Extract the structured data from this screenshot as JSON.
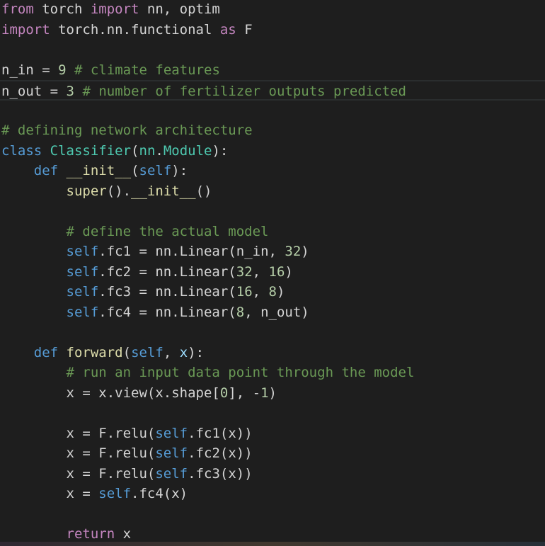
{
  "editor": {
    "lines": [
      {
        "tokens": [
          {
            "t": "from",
            "k": "keyword"
          },
          {
            "t": " torch ",
            "k": "plain"
          },
          {
            "t": "import",
            "k": "keyword"
          },
          {
            "t": " nn, optim",
            "k": "plain"
          }
        ]
      },
      {
        "tokens": [
          {
            "t": "import",
            "k": "keyword"
          },
          {
            "t": " torch.nn.functional ",
            "k": "plain"
          },
          {
            "t": "as",
            "k": "keyword"
          },
          {
            "t": " F",
            "k": "plain"
          }
        ]
      },
      {
        "tokens": []
      },
      {
        "tokens": [
          {
            "t": "n_in",
            "k": "plain"
          },
          {
            "t": " = ",
            "k": "plain"
          },
          {
            "t": "9",
            "k": "number"
          },
          {
            "t": " ",
            "k": "plain"
          },
          {
            "t": "# climate features",
            "k": "comment"
          }
        ]
      },
      {
        "current": true,
        "tokens": [
          {
            "t": "n_out",
            "k": "plain"
          },
          {
            "t": " = ",
            "k": "plain"
          },
          {
            "t": "3",
            "k": "number"
          },
          {
            "t": " ",
            "k": "plain"
          },
          {
            "t": "# number of fertilizer outputs predicted",
            "k": "comment"
          }
        ]
      },
      {
        "tokens": []
      },
      {
        "tokens": [
          {
            "t": "# defining network architecture",
            "k": "comment"
          }
        ]
      },
      {
        "tokens": [
          {
            "t": "class",
            "k": "storage"
          },
          {
            "t": " ",
            "k": "plain"
          },
          {
            "t": "Classifier",
            "k": "class"
          },
          {
            "t": "(",
            "k": "plain"
          },
          {
            "t": "nn",
            "k": "class"
          },
          {
            "t": ".",
            "k": "plain"
          },
          {
            "t": "Module",
            "k": "class"
          },
          {
            "t": "):",
            "k": "plain"
          }
        ]
      },
      {
        "tokens": [
          {
            "t": "    ",
            "k": "plain"
          },
          {
            "t": "def",
            "k": "storage"
          },
          {
            "t": " ",
            "k": "plain"
          },
          {
            "t": "__init__",
            "k": "func"
          },
          {
            "t": "(",
            "k": "plain"
          },
          {
            "t": "self",
            "k": "self"
          },
          {
            "t": "):",
            "k": "plain"
          }
        ]
      },
      {
        "tokens": [
          {
            "t": "        ",
            "k": "plain"
          },
          {
            "t": "super",
            "k": "func"
          },
          {
            "t": "().",
            "k": "plain"
          },
          {
            "t": "__init__",
            "k": "func"
          },
          {
            "t": "()",
            "k": "plain"
          }
        ]
      },
      {
        "tokens": []
      },
      {
        "tokens": [
          {
            "t": "        ",
            "k": "plain"
          },
          {
            "t": "# define the actual model",
            "k": "comment"
          }
        ]
      },
      {
        "tokens": [
          {
            "t": "        ",
            "k": "plain"
          },
          {
            "t": "self",
            "k": "self"
          },
          {
            "t": ".fc1 = nn.",
            "k": "plain"
          },
          {
            "t": "Linear",
            "k": "plain"
          },
          {
            "t": "(n_in, ",
            "k": "plain"
          },
          {
            "t": "32",
            "k": "number"
          },
          {
            "t": ")",
            "k": "plain"
          }
        ]
      },
      {
        "tokens": [
          {
            "t": "        ",
            "k": "plain"
          },
          {
            "t": "self",
            "k": "self"
          },
          {
            "t": ".fc2 = nn.Linear(",
            "k": "plain"
          },
          {
            "t": "32",
            "k": "number"
          },
          {
            "t": ", ",
            "k": "plain"
          },
          {
            "t": "16",
            "k": "number"
          },
          {
            "t": ")",
            "k": "plain"
          }
        ]
      },
      {
        "tokens": [
          {
            "t": "        ",
            "k": "plain"
          },
          {
            "t": "self",
            "k": "self"
          },
          {
            "t": ".fc3 = nn.Linear(",
            "k": "plain"
          },
          {
            "t": "16",
            "k": "number"
          },
          {
            "t": ", ",
            "k": "plain"
          },
          {
            "t": "8",
            "k": "number"
          },
          {
            "t": ")",
            "k": "plain"
          }
        ]
      },
      {
        "tokens": [
          {
            "t": "        ",
            "k": "plain"
          },
          {
            "t": "self",
            "k": "self"
          },
          {
            "t": ".fc4 = nn.Linear(",
            "k": "plain"
          },
          {
            "t": "8",
            "k": "number"
          },
          {
            "t": ", n_out)",
            "k": "plain"
          }
        ]
      },
      {
        "tokens": []
      },
      {
        "tokens": [
          {
            "t": "    ",
            "k": "plain"
          },
          {
            "t": "def",
            "k": "storage"
          },
          {
            "t": " ",
            "k": "plain"
          },
          {
            "t": "forward",
            "k": "func"
          },
          {
            "t": "(",
            "k": "plain"
          },
          {
            "t": "self",
            "k": "self"
          },
          {
            "t": ", ",
            "k": "plain"
          },
          {
            "t": "x",
            "k": "param"
          },
          {
            "t": "):",
            "k": "plain"
          }
        ]
      },
      {
        "tokens": [
          {
            "t": "        ",
            "k": "plain"
          },
          {
            "t": "# run an input data point through the model",
            "k": "comment"
          }
        ]
      },
      {
        "tokens": [
          {
            "t": "        ",
            "k": "plain"
          },
          {
            "t": "x = x.view(x.shape[",
            "k": "plain"
          },
          {
            "t": "0",
            "k": "number"
          },
          {
            "t": "], -",
            "k": "plain"
          },
          {
            "t": "1",
            "k": "number"
          },
          {
            "t": ")",
            "k": "plain"
          }
        ]
      },
      {
        "tokens": []
      },
      {
        "tokens": [
          {
            "t": "        ",
            "k": "plain"
          },
          {
            "t": "x = F.relu(",
            "k": "plain"
          },
          {
            "t": "self",
            "k": "self"
          },
          {
            "t": ".fc1(x))",
            "k": "plain"
          }
        ]
      },
      {
        "tokens": [
          {
            "t": "        ",
            "k": "plain"
          },
          {
            "t": "x = F.relu(",
            "k": "plain"
          },
          {
            "t": "self",
            "k": "self"
          },
          {
            "t": ".fc2(x))",
            "k": "plain"
          }
        ]
      },
      {
        "tokens": [
          {
            "t": "        ",
            "k": "plain"
          },
          {
            "t": "x = F.relu(",
            "k": "plain"
          },
          {
            "t": "self",
            "k": "self"
          },
          {
            "t": ".fc3(x))",
            "k": "plain"
          }
        ]
      },
      {
        "tokens": [
          {
            "t": "        ",
            "k": "plain"
          },
          {
            "t": "x = ",
            "k": "plain"
          },
          {
            "t": "self",
            "k": "self"
          },
          {
            "t": ".fc4(x)",
            "k": "plain"
          }
        ]
      },
      {
        "tokens": []
      },
      {
        "tokens": [
          {
            "t": "        ",
            "k": "plain"
          },
          {
            "t": "return",
            "k": "keyword"
          },
          {
            "t": " x",
            "k": "plain"
          }
        ]
      }
    ]
  },
  "theme": {
    "background": "#1e1e1e",
    "keyword": "#c586c0",
    "storage": "#569cd6",
    "class": "#4ec9b0",
    "function": "#dcdcaa",
    "number": "#b5cea8",
    "comment": "#6a9955",
    "text": "#d4d4d4"
  }
}
